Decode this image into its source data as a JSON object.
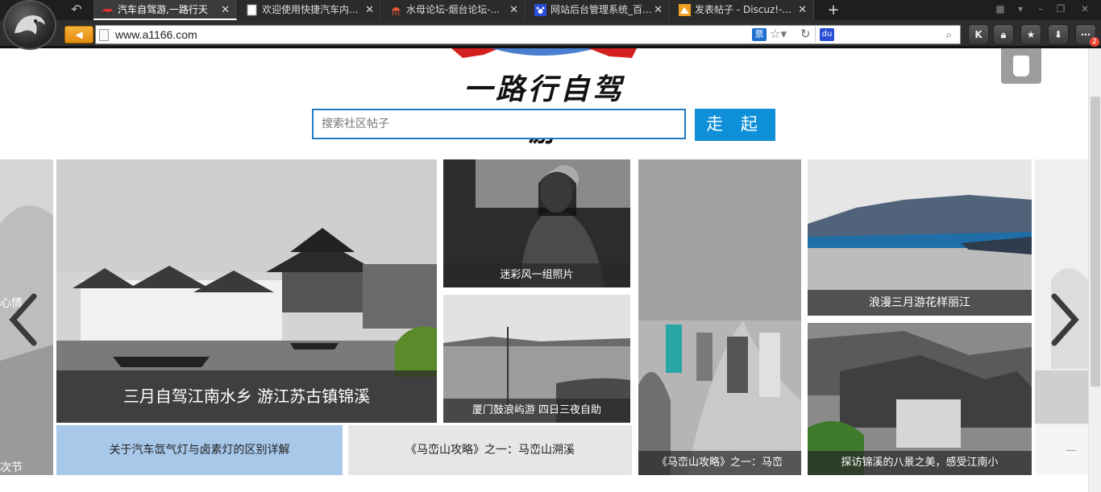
{
  "browser": {
    "tabs": [
      {
        "title": "汽车自驾游,一路行天",
        "active": true
      },
      {
        "title": "欢迎使用快捷汽车内...",
        "active": false
      },
      {
        "title": "水母论坛-烟台论坛-...",
        "active": false
      },
      {
        "title": "网站后台管理系统_百...",
        "active": false
      },
      {
        "title": "发表帖子 - Discuz!-...",
        "active": false
      }
    ],
    "new_tab": "+",
    "url": "www.a1166.com",
    "ticket_label": "票",
    "baidu_label": "du",
    "notification_count": "2",
    "toolbar_k": "K"
  },
  "site": {
    "logo_text": "一路行自驾游",
    "search": {
      "placeholder": "搜索社区帖子",
      "button": "走 起"
    }
  },
  "carousel": {
    "left_partial": {
      "top_text": "心情",
      "bottom_text": "次节"
    },
    "right_partial": {
      "bottom_text": "一"
    },
    "tiles": [
      {
        "caption": "三月自驾江南水乡 游江苏古镇锦溪"
      },
      {
        "caption": "迷彩风一组照片"
      },
      {
        "caption": "厦门鼓浪屿游 四日三夜自助"
      },
      {
        "caption": "《马峦山攻略》之一：马峦"
      },
      {
        "caption": "浪漫三月游花样丽江"
      },
      {
        "caption": "探访锦溪的八景之美，感受江南小"
      }
    ],
    "text_links": [
      {
        "label": "关于汽车氙气灯与卤素灯的区别详解"
      },
      {
        "label": "《马峦山攻略》之一：马峦山溯溪"
      }
    ]
  },
  "colors": {
    "accent": "#0e8fd8",
    "highlight_cell": "#a8c8ea",
    "plain_cell": "#e6e6e6"
  }
}
